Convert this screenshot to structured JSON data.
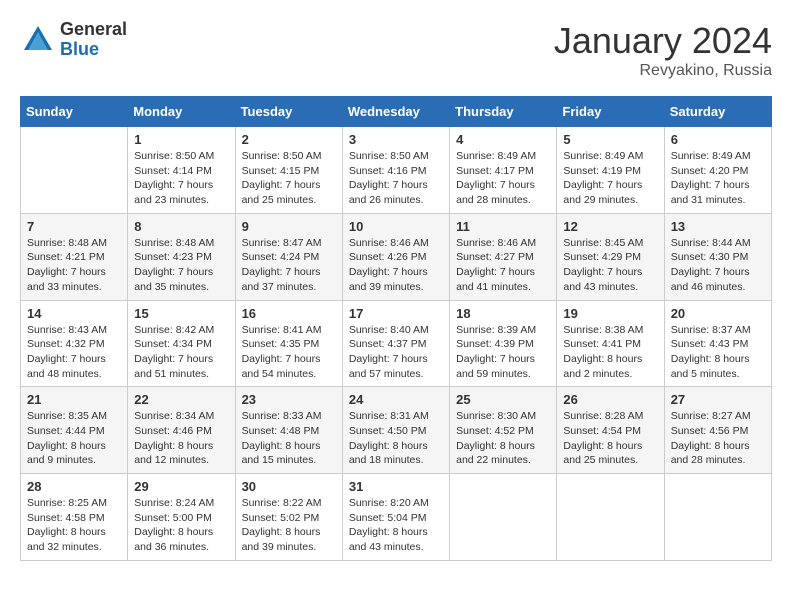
{
  "logo": {
    "general": "General",
    "blue": "Blue"
  },
  "title": "January 2024",
  "subtitle": "Revyakino, Russia",
  "days_header": [
    "Sunday",
    "Monday",
    "Tuesday",
    "Wednesday",
    "Thursday",
    "Friday",
    "Saturday"
  ],
  "weeks": [
    [
      {
        "day": "",
        "info": ""
      },
      {
        "day": "1",
        "info": "Sunrise: 8:50 AM\nSunset: 4:14 PM\nDaylight: 7 hours\nand 23 minutes."
      },
      {
        "day": "2",
        "info": "Sunrise: 8:50 AM\nSunset: 4:15 PM\nDaylight: 7 hours\nand 25 minutes."
      },
      {
        "day": "3",
        "info": "Sunrise: 8:50 AM\nSunset: 4:16 PM\nDaylight: 7 hours\nand 26 minutes."
      },
      {
        "day": "4",
        "info": "Sunrise: 8:49 AM\nSunset: 4:17 PM\nDaylight: 7 hours\nand 28 minutes."
      },
      {
        "day": "5",
        "info": "Sunrise: 8:49 AM\nSunset: 4:19 PM\nDaylight: 7 hours\nand 29 minutes."
      },
      {
        "day": "6",
        "info": "Sunrise: 8:49 AM\nSunset: 4:20 PM\nDaylight: 7 hours\nand 31 minutes."
      }
    ],
    [
      {
        "day": "7",
        "info": "Sunrise: 8:48 AM\nSunset: 4:21 PM\nDaylight: 7 hours\nand 33 minutes."
      },
      {
        "day": "8",
        "info": "Sunrise: 8:48 AM\nSunset: 4:23 PM\nDaylight: 7 hours\nand 35 minutes."
      },
      {
        "day": "9",
        "info": "Sunrise: 8:47 AM\nSunset: 4:24 PM\nDaylight: 7 hours\nand 37 minutes."
      },
      {
        "day": "10",
        "info": "Sunrise: 8:46 AM\nSunset: 4:26 PM\nDaylight: 7 hours\nand 39 minutes."
      },
      {
        "day": "11",
        "info": "Sunrise: 8:46 AM\nSunset: 4:27 PM\nDaylight: 7 hours\nand 41 minutes."
      },
      {
        "day": "12",
        "info": "Sunrise: 8:45 AM\nSunset: 4:29 PM\nDaylight: 7 hours\nand 43 minutes."
      },
      {
        "day": "13",
        "info": "Sunrise: 8:44 AM\nSunset: 4:30 PM\nDaylight: 7 hours\nand 46 minutes."
      }
    ],
    [
      {
        "day": "14",
        "info": "Sunrise: 8:43 AM\nSunset: 4:32 PM\nDaylight: 7 hours\nand 48 minutes."
      },
      {
        "day": "15",
        "info": "Sunrise: 8:42 AM\nSunset: 4:34 PM\nDaylight: 7 hours\nand 51 minutes."
      },
      {
        "day": "16",
        "info": "Sunrise: 8:41 AM\nSunset: 4:35 PM\nDaylight: 7 hours\nand 54 minutes."
      },
      {
        "day": "17",
        "info": "Sunrise: 8:40 AM\nSunset: 4:37 PM\nDaylight: 7 hours\nand 57 minutes."
      },
      {
        "day": "18",
        "info": "Sunrise: 8:39 AM\nSunset: 4:39 PM\nDaylight: 7 hours\nand 59 minutes."
      },
      {
        "day": "19",
        "info": "Sunrise: 8:38 AM\nSunset: 4:41 PM\nDaylight: 8 hours\nand 2 minutes."
      },
      {
        "day": "20",
        "info": "Sunrise: 8:37 AM\nSunset: 4:43 PM\nDaylight: 8 hours\nand 5 minutes."
      }
    ],
    [
      {
        "day": "21",
        "info": "Sunrise: 8:35 AM\nSunset: 4:44 PM\nDaylight: 8 hours\nand 9 minutes."
      },
      {
        "day": "22",
        "info": "Sunrise: 8:34 AM\nSunset: 4:46 PM\nDaylight: 8 hours\nand 12 minutes."
      },
      {
        "day": "23",
        "info": "Sunrise: 8:33 AM\nSunset: 4:48 PM\nDaylight: 8 hours\nand 15 minutes."
      },
      {
        "day": "24",
        "info": "Sunrise: 8:31 AM\nSunset: 4:50 PM\nDaylight: 8 hours\nand 18 minutes."
      },
      {
        "day": "25",
        "info": "Sunrise: 8:30 AM\nSunset: 4:52 PM\nDaylight: 8 hours\nand 22 minutes."
      },
      {
        "day": "26",
        "info": "Sunrise: 8:28 AM\nSunset: 4:54 PM\nDaylight: 8 hours\nand 25 minutes."
      },
      {
        "day": "27",
        "info": "Sunrise: 8:27 AM\nSunset: 4:56 PM\nDaylight: 8 hours\nand 28 minutes."
      }
    ],
    [
      {
        "day": "28",
        "info": "Sunrise: 8:25 AM\nSunset: 4:58 PM\nDaylight: 8 hours\nand 32 minutes."
      },
      {
        "day": "29",
        "info": "Sunrise: 8:24 AM\nSunset: 5:00 PM\nDaylight: 8 hours\nand 36 minutes."
      },
      {
        "day": "30",
        "info": "Sunrise: 8:22 AM\nSunset: 5:02 PM\nDaylight: 8 hours\nand 39 minutes."
      },
      {
        "day": "31",
        "info": "Sunrise: 8:20 AM\nSunset: 5:04 PM\nDaylight: 8 hours\nand 43 minutes."
      },
      {
        "day": "",
        "info": ""
      },
      {
        "day": "",
        "info": ""
      },
      {
        "day": "",
        "info": ""
      }
    ]
  ]
}
